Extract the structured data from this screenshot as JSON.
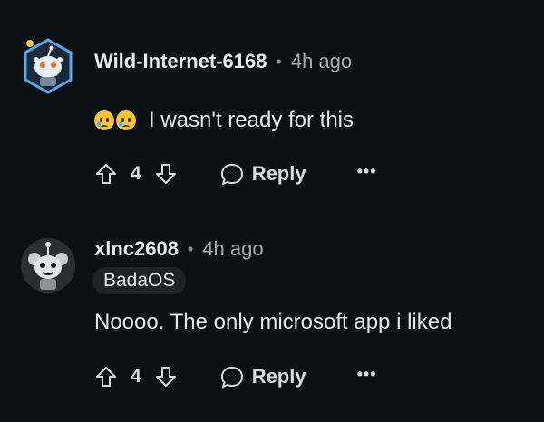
{
  "comments": [
    {
      "username": "Wild-Internet-6168",
      "separator": "•",
      "time": "4h ago",
      "body": "I wasn't ready for this",
      "emoji_icons": [
        "crying-face-icon",
        "crying-face-icon"
      ],
      "vote_count": "4",
      "reply_label": "Reply",
      "more_label": "•••"
    },
    {
      "username": "xlnc2608",
      "separator": "•",
      "time": "4h ago",
      "flair": "BadaOS",
      "body": "Noooo. The only microsoft app i liked",
      "vote_count": "4",
      "reply_label": "Reply",
      "more_label": "•••"
    }
  ],
  "colors": {
    "background": "#0b1014",
    "text": "#d7dadc",
    "muted": "#a7abae",
    "avatar_hex_border": "#4aa0e0",
    "flair_bg": "#1e2326"
  }
}
